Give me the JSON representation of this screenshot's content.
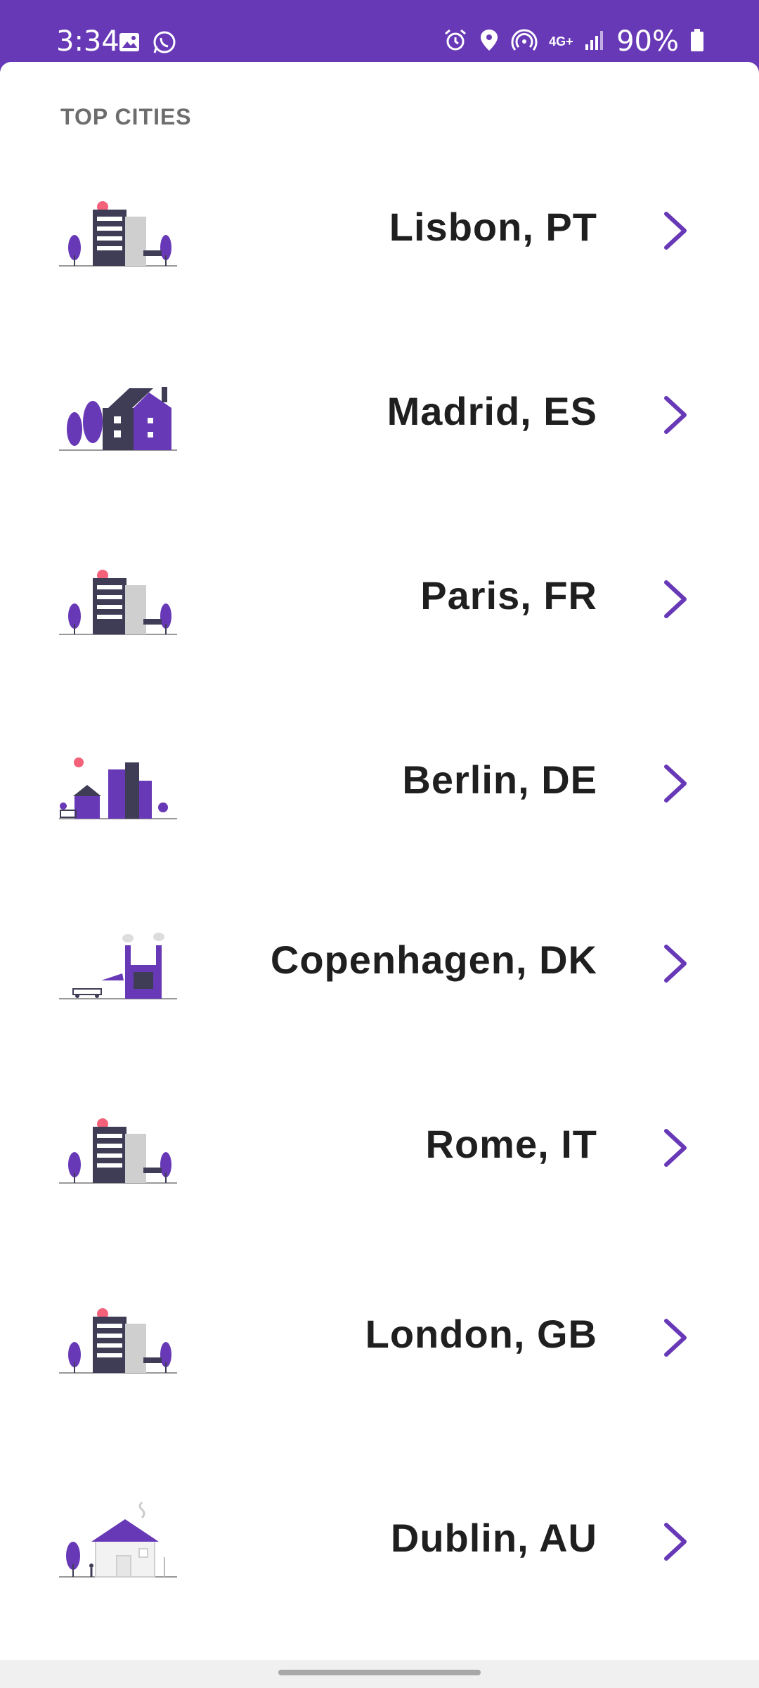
{
  "status_bar": {
    "time": "3:34",
    "battery_percent": "90%",
    "network": "4G+",
    "icons": [
      "gallery-icon",
      "whatsapp-icon",
      "alarm-icon",
      "location-icon",
      "hotspot-icon",
      "network-icon",
      "signal-icon",
      "battery-icon"
    ]
  },
  "section": {
    "title": "TOP CITIES"
  },
  "cities": [
    {
      "name": "Lisbon, PT",
      "illustration": "building-illustration"
    },
    {
      "name": "Madrid, ES",
      "illustration": "house-illustration"
    },
    {
      "name": "Paris, FR",
      "illustration": "building-illustration"
    },
    {
      "name": "Berlin, DE",
      "illustration": "city-skyline-illustration"
    },
    {
      "name": "Copenhagen, DK",
      "illustration": "factory-illustration"
    },
    {
      "name": "Rome, IT",
      "illustration": "building-illustration"
    },
    {
      "name": "London, GB",
      "illustration": "building-illustration"
    },
    {
      "name": "Dublin, AU",
      "illustration": "cottage-illustration"
    }
  ],
  "colors": {
    "accent": "#6839b7",
    "text": "#1f1f1f",
    "section_title": "#6d6d6d"
  }
}
